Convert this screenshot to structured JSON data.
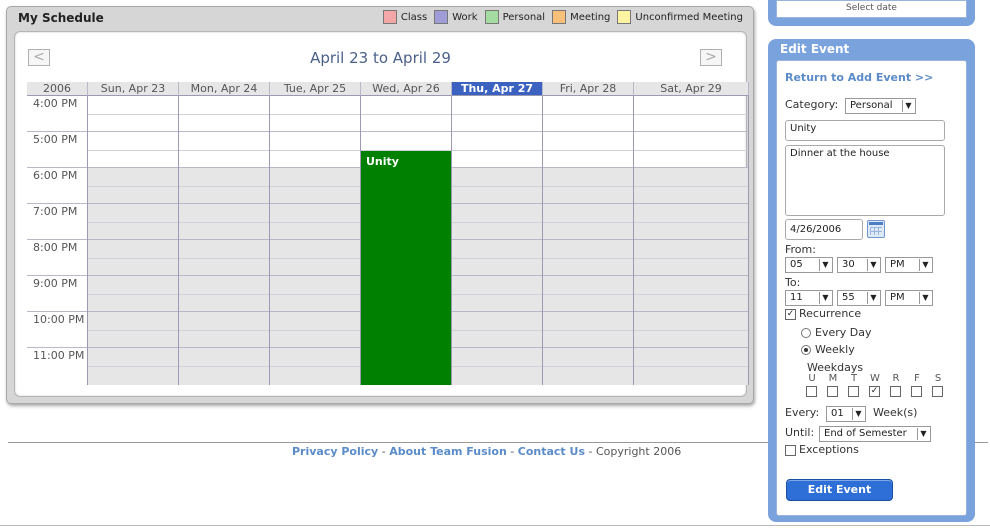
{
  "schedule": {
    "title": "My Schedule",
    "date_range": "April 23 to April 29",
    "prev_label": "<",
    "next_label": ">",
    "year_label": "2006",
    "legend": [
      {
        "label": "Class",
        "color": "#f4a7a7"
      },
      {
        "label": "Work",
        "color": "#a09cd8"
      },
      {
        "label": "Personal",
        "color": "#a4dba0"
      },
      {
        "label": "Meeting",
        "color": "#f8c07a"
      },
      {
        "label": "Unconfirmed Meeting",
        "color": "#fdf3a0"
      }
    ],
    "days": [
      "Sun, Apr 23",
      "Mon, Apr 24",
      "Tue, Apr 25",
      "Wed, Apr 26",
      "Thu, Apr 27",
      "Fri, Apr 28",
      "Sat, Apr 29"
    ],
    "today_index": 4,
    "times": [
      "4:00 PM",
      "5:00 PM",
      "6:00 PM",
      "7:00 PM",
      "8:00 PM",
      "9:00 PM",
      "10:00 PM",
      "11:00 PM"
    ],
    "event": {
      "title": "Unity",
      "color": "#008000",
      "day_index": 3,
      "start": "5:30 PM",
      "end": "11:55 PM"
    }
  },
  "edit": {
    "top_fragment": "Select date",
    "title": "Edit Event",
    "return_link": "Return to Add Event >>",
    "category_label": "Category:",
    "category_value": "Personal",
    "event_title": "Unity",
    "description": "Dinner at the house",
    "date": "4/26/2006",
    "from_label": "From:",
    "from": {
      "hour": "05",
      "minute": "30",
      "ampm": "PM"
    },
    "to_label": "To:",
    "to": {
      "hour": "11",
      "minute": "55",
      "ampm": "PM"
    },
    "recurrence_label": "Recurrence",
    "recurrence_checked": true,
    "every_day_label": "Every Day",
    "weekly_label": "Weekly",
    "weekdays_label": "Weekdays",
    "weekdays": [
      "U",
      "M",
      "T",
      "W",
      "R",
      "F",
      "S"
    ],
    "weekdays_checked": [
      false,
      false,
      false,
      true,
      false,
      false,
      false
    ],
    "every_label": "Every:",
    "every_value": "01",
    "weeks_label": "Week(s)",
    "until_label": "Until:",
    "until_value": "End of Semester",
    "exceptions_label": "Exceptions",
    "submit_label": "Edit Event"
  },
  "footer": {
    "privacy": "Privacy Policy",
    "about": "About Team Fusion",
    "contact": "Contact Us",
    "sep": " - ",
    "copyright": "Copyright 2006"
  }
}
